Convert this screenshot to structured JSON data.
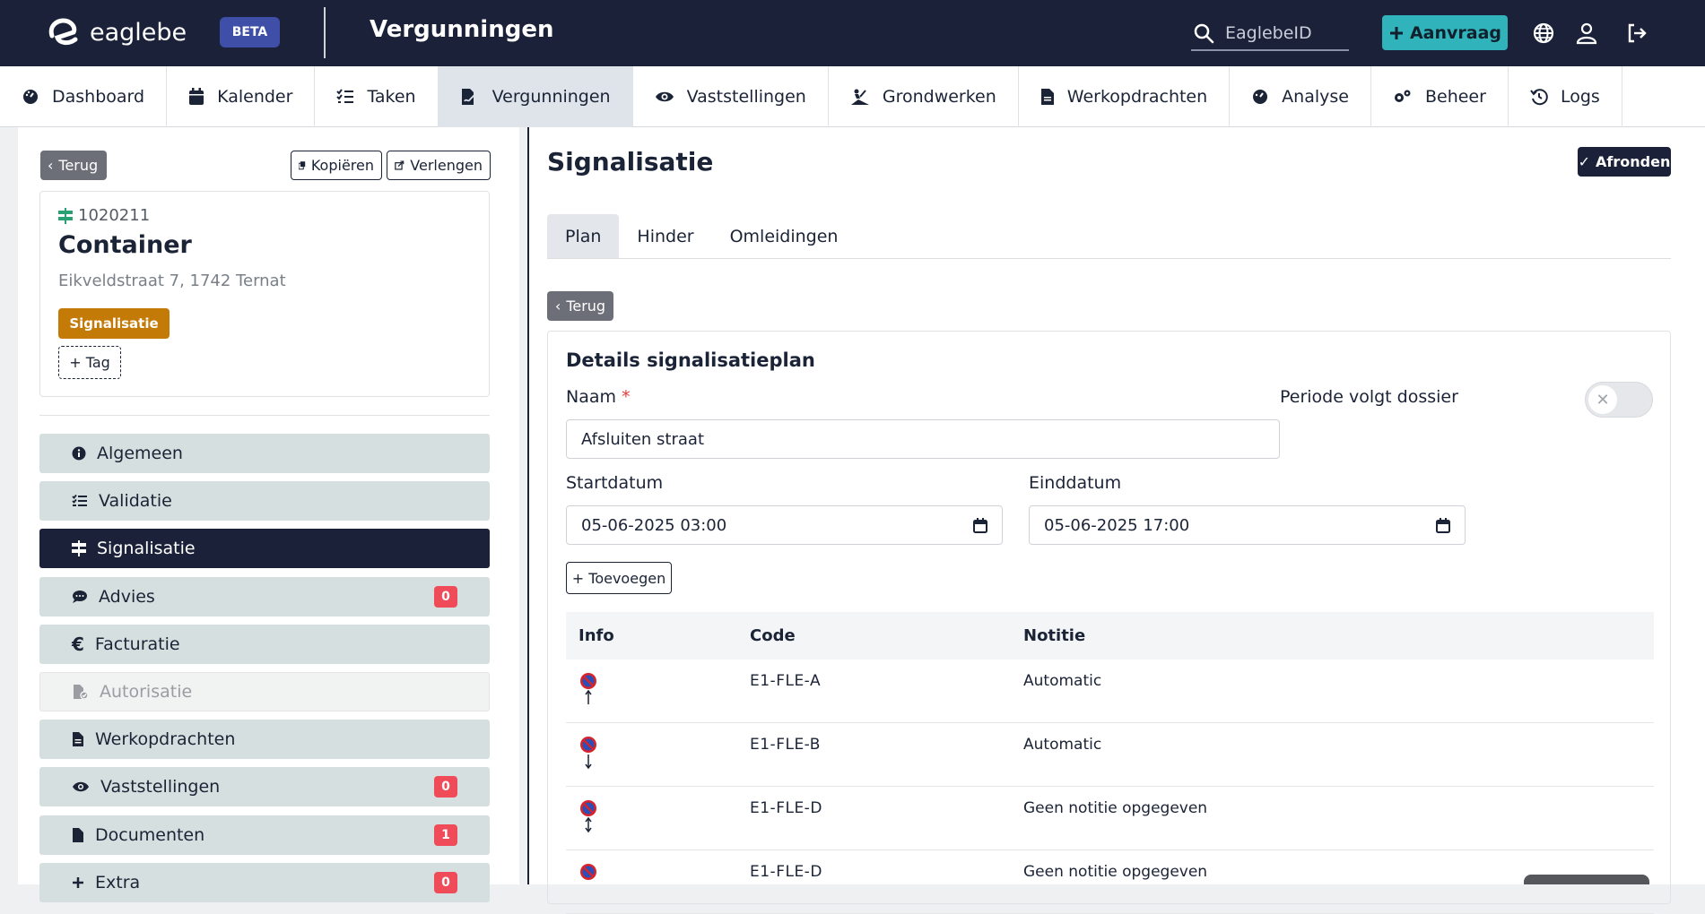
{
  "topbar": {
    "logo_text": "eaglebe",
    "beta_label": "BETA",
    "page_title": "Vergunningen",
    "search_placeholder": "EaglebeID",
    "aanvraag_label": "Aanvraag",
    "icons": [
      "search-icon",
      "plus-icon",
      "globe-icon",
      "user-icon",
      "logout-icon"
    ]
  },
  "nav": {
    "items": [
      {
        "label": "Dashboard",
        "icon": "gauge-icon"
      },
      {
        "label": "Kalender",
        "icon": "calendar-icon"
      },
      {
        "label": "Taken",
        "icon": "tasks-icon"
      },
      {
        "label": "Vergunningen",
        "icon": "file-signature-icon",
        "active": true
      },
      {
        "label": "Vaststellingen",
        "icon": "eye-icon"
      },
      {
        "label": "Grondwerken",
        "icon": "digging-icon"
      },
      {
        "label": "Werkopdrachten",
        "icon": "document-icon"
      },
      {
        "label": "Analyse",
        "icon": "gauge-icon"
      },
      {
        "label": "Beheer",
        "icon": "cogs-icon"
      },
      {
        "label": "Logs",
        "icon": "history-icon"
      }
    ]
  },
  "left": {
    "back_label": "Terug",
    "copy_label": "Kopiëren",
    "extend_label": "Verlengen",
    "card": {
      "number": "1020211",
      "title": "Container",
      "address": "Eikveldstraat 7, 1742 Ternat",
      "tag": "Signalisatie",
      "add_tag": "+ Tag"
    },
    "menu": [
      {
        "label": "Algemeen",
        "icon": "info-icon"
      },
      {
        "label": "Validatie",
        "icon": "checklist-icon"
      },
      {
        "label": "Signalisatie",
        "icon": "signpost-icon",
        "active": true
      },
      {
        "label": "Advies",
        "icon": "comments-icon",
        "badge": "0"
      },
      {
        "label": "Facturatie",
        "icon": "euro-icon"
      },
      {
        "label": "Autorisatie",
        "icon": "file-check-icon",
        "disabled": true
      },
      {
        "label": "Werkopdrachten",
        "icon": "document-icon"
      },
      {
        "label": "Vaststellingen",
        "icon": "eye-icon",
        "badge": "0"
      },
      {
        "label": "Documenten",
        "icon": "file-icon",
        "badge": "1"
      },
      {
        "label": "Extra",
        "icon": "plus-icon",
        "badge": "0"
      }
    ]
  },
  "main": {
    "title": "Signalisatie",
    "afronden_label": "Afronden",
    "tabs": [
      "Plan",
      "Hinder",
      "Omleidingen"
    ],
    "back_label": "Terug",
    "details": {
      "title": "Details signalisatieplan",
      "naam_label": "Naam",
      "naam_required": "*",
      "naam_value": "Afsluiten straat",
      "periode_label": "Periode volgt dossier",
      "periode_toggle": false,
      "start_label": "Startdatum",
      "start_value": "05-06-2025 03:00",
      "end_label": "Einddatum",
      "end_value": "05-06-2025 17:00",
      "add_label": "+ Toevoegen",
      "table": {
        "headers": [
          "Info",
          "Code",
          "Notitie"
        ],
        "rows": [
          {
            "code": "E1-FLE-A",
            "note": "Automatic",
            "arrow": "up"
          },
          {
            "code": "E1-FLE-B",
            "note": "Automatic",
            "arrow": "down"
          },
          {
            "code": "E1-FLE-D",
            "note": "Geen notitie opgegeven",
            "arrow": "both"
          },
          {
            "code": "E1-FLE-D",
            "note": "Geen notitie opgegeven",
            "arrow": "both"
          }
        ]
      }
    }
  },
  "colors": {
    "navy": "#1a2138",
    "teal": "#31b3bb",
    "orange": "#c47a06",
    "badge_red": "#ef4b59",
    "menu_bg": "#d6dfdf"
  }
}
